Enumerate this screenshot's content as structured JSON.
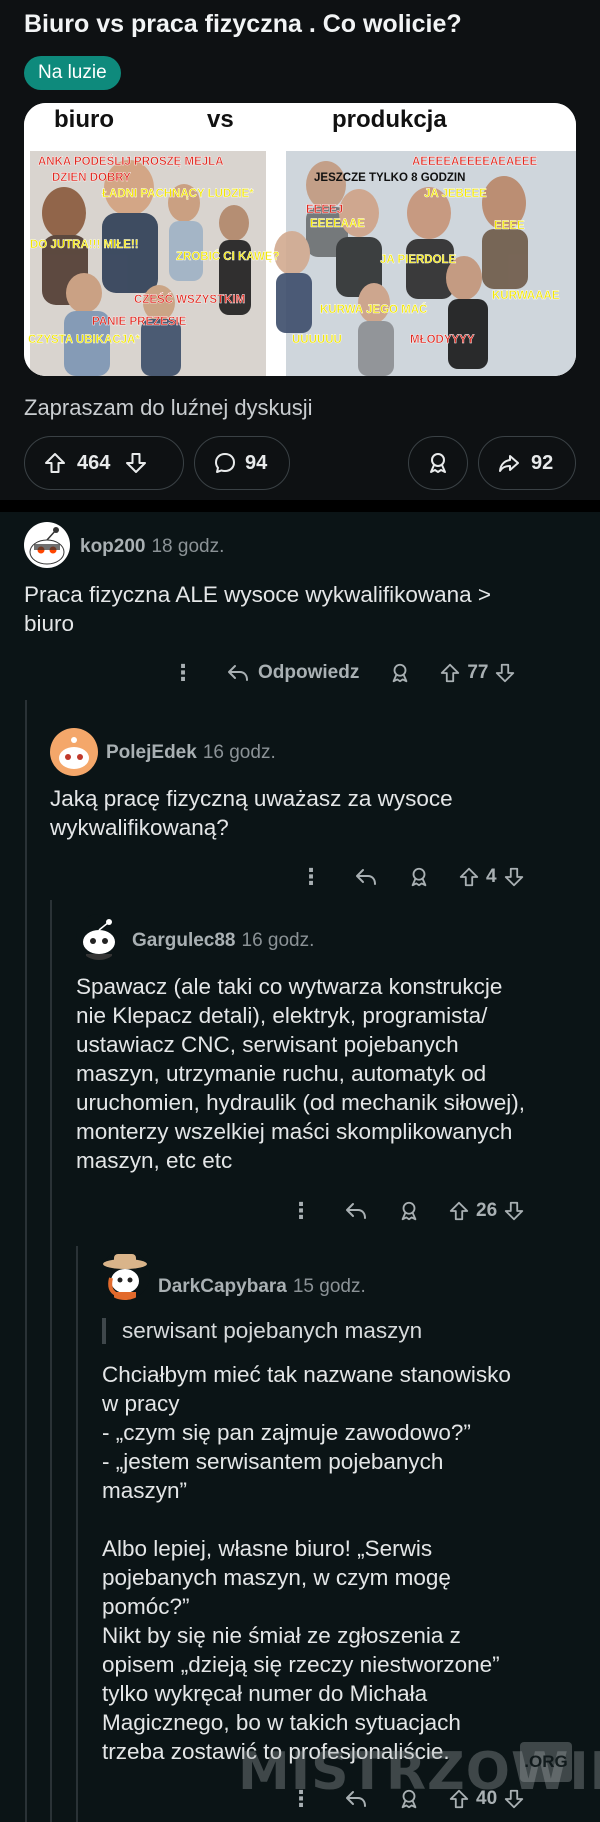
{
  "post": {
    "title": "Biuro vs praca fizyczna . Co wolicie?",
    "flair": "Na luzie",
    "body": "Zapraszam do luźnej dyskusji",
    "upvotes": "464",
    "comments": "94",
    "shares": "92",
    "meme": {
      "header_left": "biuro",
      "header_mid": "vs",
      "header_right": "produkcja",
      "left_captions": [
        "ANKA PODEŚLIJ PROSZĘ MEJLA",
        "DZIEŃ DOBRY",
        "ŁADNI PACHNĄCY LUDZIE*",
        "DO JUTRA!!! MIŁE!!",
        "ZROBIĆ CI KAWĘ?",
        "CZEŚĆ WSZYSTKIM",
        "PANIE PREZESIE",
        "CZYSTA UBIKACJA*"
      ],
      "right_captions": [
        "AEEEEAEEEEAEAEEE",
        "JESZCZE TYLKO 8 GODZIN",
        "JA JEBEEE",
        "EEEEJ",
        "EEEEAAE",
        "EEEE",
        "JA PIERDOLE",
        "KURWAAAE",
        "KURWA JEGO MAĆ",
        "UUUUUU",
        "MŁODYYYY"
      ]
    }
  },
  "comments": [
    {
      "author": "kop200",
      "time": "18 godz.",
      "text": "Praca fizyczna ALE wysoce wykwalifikowana >\nbiuro",
      "reply_label": "Odpowiedz",
      "score": "77"
    },
    {
      "author": "PolejEdek",
      "time": "16 godz.",
      "text": "Jaką pracę fizyczną uważasz za wysoce\nwykwalifikowaną?",
      "score": "4"
    },
    {
      "author": "Gargulec88",
      "time": "16 godz.",
      "text": "Spawacz (ale taki co wytwarza konstrukcje\nnie Klepacz detali), elektryk, programista/\nustawiacz CNC, serwisant pojebanych\nmaszyn, utrzymanie ruchu, automatyk od\nuruchomien, hydraulik (od mechanik siłowej),\nmonterzy wszelkiej maści skomplikowanych\nmaszyn, etc etc",
      "score": "26"
    },
    {
      "author": "DarkCapybara",
      "time": "15 godz.",
      "quote": "serwisant pojebanych maszyn",
      "text": "Chciałbym mieć tak nazwane stanowisko\nw pracy\n- „czym się pan zajmuje zawodowo?”\n- „jestem serwisantem pojebanych\nmaszyn”\n\nAlbo lepiej, własne biuro! „Serwis\npojebanych maszyn, w czym mogę\npomóc?”\nNikt by się nie śmiał ze zgłoszenia z\nopisem „dzieją się rzeczy niestworzone”\ntylko wykręcał numer do Michała\nMagicznego, bo w takich sytuacjach\ntrzeba zostawić to profesjonaliście.",
      "score": "40"
    }
  ],
  "watermark": {
    "text": "MISTRZOWIE",
    "suffix": ".ORG"
  },
  "colors": {
    "background": "#0b1416",
    "flair": "#0e8a7c",
    "meme_red": "#e0281f",
    "meme_yellow": "#f2e600"
  },
  "icons": [
    "upvote-icon",
    "downvote-icon",
    "comment-icon",
    "award-icon",
    "share-icon",
    "reply-icon",
    "more-icon"
  ]
}
